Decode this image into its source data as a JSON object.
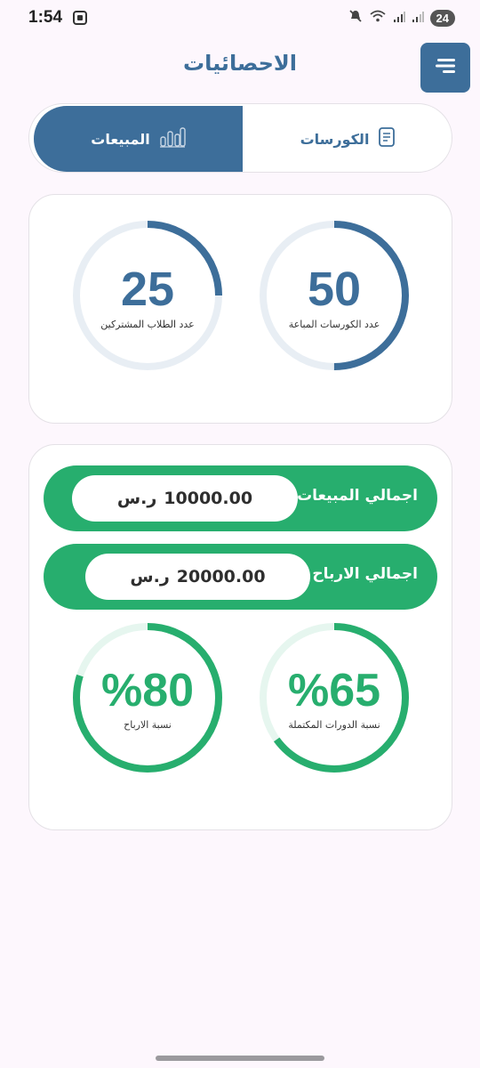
{
  "status": {
    "time": "1:54",
    "battery": "24",
    "icons": [
      "screenshot-icon",
      "mute-icon",
      "wifi-icon",
      "signal-icon",
      "signal-icon"
    ]
  },
  "header": {
    "title": "الاحصائيات",
    "menu_icon": "menu-icon"
  },
  "tabs": [
    {
      "label": "الكورسات",
      "icon": "document-icon",
      "selected": false
    },
    {
      "label": "المبيعات",
      "icon": "bar-chart-icon",
      "selected": true
    }
  ],
  "stats": [
    {
      "value": "50",
      "label": "عدد الكورسات المباعة",
      "progress": 0.5
    },
    {
      "value": "25",
      "label": "عدد الطلاب المشتركين",
      "progress": 0.25
    }
  ],
  "totals": [
    {
      "label": "اجمالي المبيعات",
      "amount": "10000.00",
      "currency": "ر.س"
    },
    {
      "label": "اجمالي الارباح",
      "amount": "20000.00",
      "currency": "ر.س"
    }
  ],
  "percentages": [
    {
      "value": "%65",
      "label": "نسبة الدورات المكتملة",
      "progress": 0.65
    },
    {
      "value": "%80",
      "label": "نسبة الارباح",
      "progress": 0.8
    }
  ],
  "colors": {
    "primary": "#3d6e9a",
    "success": "#27ae6e",
    "track_blue": "#e8eef4",
    "track_green": "#e6f6ef",
    "background": "#fdf7fd"
  }
}
